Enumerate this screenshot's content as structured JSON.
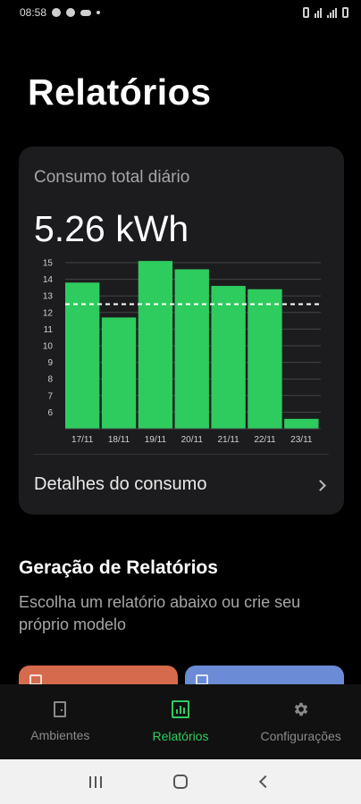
{
  "status_bar": {
    "time": "08:58"
  },
  "header": {
    "title": "Relatórios"
  },
  "consumption_card": {
    "label": "Consumo total diário",
    "value": "5.26 kWh",
    "details_label": "Detalhes do consumo"
  },
  "chart_data": {
    "type": "bar",
    "categories": [
      "17/11",
      "18/11",
      "19/11",
      "20/11",
      "21/11",
      "22/11",
      "23/11"
    ],
    "values": [
      13.8,
      11.7,
      15.1,
      14.6,
      13.6,
      13.4,
      5.6
    ],
    "y_ticks": [
      "6",
      "7",
      "8",
      "9",
      "10",
      "11",
      "12",
      "13",
      "14",
      "15"
    ],
    "ylim": [
      5,
      15
    ],
    "reference_line": 12.5,
    "grid": true,
    "colors": {
      "bar": "#2ecc5e",
      "grid": "#444444",
      "reference": "#ffffff"
    }
  },
  "reports_section": {
    "title": "Geração de Relatórios",
    "description": "Escolha um relatório abaixo ou crie seu próprio modelo"
  },
  "bottom_nav": {
    "items": [
      {
        "label": "Ambientes"
      },
      {
        "label": "Relatórios"
      },
      {
        "label": "Configurações"
      }
    ]
  },
  "colors": {
    "accent": "#2ecc5e",
    "card": "#1c1c1e",
    "tile_orange": "#d66a4d",
    "tile_blue": "#6c8bd6"
  }
}
